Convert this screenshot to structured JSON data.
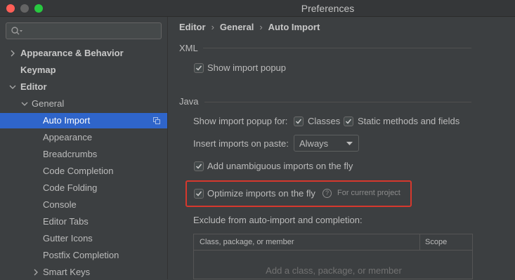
{
  "window": {
    "title": "Preferences"
  },
  "sidebar": {
    "search": {
      "placeholder": ""
    },
    "items": [
      {
        "label": "Appearance & Behavior"
      },
      {
        "label": "Keymap"
      },
      {
        "label": "Editor"
      },
      {
        "label": "General"
      },
      {
        "label": "Auto Import"
      },
      {
        "label": "Appearance"
      },
      {
        "label": "Breadcrumbs"
      },
      {
        "label": "Code Completion"
      },
      {
        "label": "Code Folding"
      },
      {
        "label": "Console"
      },
      {
        "label": "Editor Tabs"
      },
      {
        "label": "Gutter Icons"
      },
      {
        "label": "Postfix Completion"
      },
      {
        "label": "Smart Keys"
      }
    ]
  },
  "breadcrumb": {
    "level1": "Editor",
    "level2": "General",
    "level3": "Auto Import"
  },
  "xml": {
    "header": "XML",
    "show_popup": {
      "label": "Show import popup",
      "checked": true
    }
  },
  "java": {
    "header": "Java",
    "popup_for_label": "Show import popup for:",
    "classes": {
      "label": "Classes",
      "checked": true
    },
    "static_methods": {
      "label": "Static methods and fields",
      "checked": true
    },
    "insert_label": "Insert imports on paste:",
    "insert_value": "Always",
    "unambiguous": {
      "label": "Add unambiguous imports on the fly",
      "checked": true
    },
    "optimize": {
      "label": "Optimize imports on the fly",
      "checked": true,
      "hint": "For current project"
    },
    "help_glyph": "?",
    "exclude_label": "Exclude from auto-import and completion:",
    "table": {
      "columns": [
        "Class, package, or member",
        "Scope"
      ],
      "empty_text": "Add a class, package, or member"
    }
  },
  "colors": {
    "accent": "#2f65ca",
    "highlight": "#d6382d"
  }
}
